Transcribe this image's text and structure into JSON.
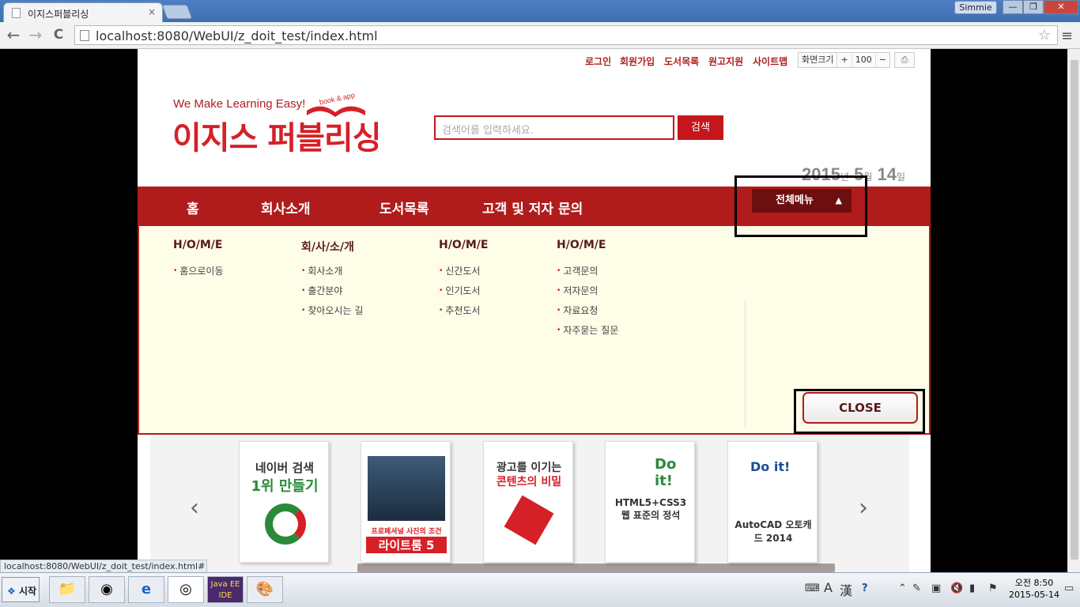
{
  "browser": {
    "tab_title": "이지스퍼블리싱",
    "tab_close": "×",
    "user": "Simmie",
    "win_min": "—",
    "win_restore": "❐",
    "win_close": "✕",
    "back": "←",
    "forward": "→",
    "reload": "C",
    "url": "localhost:8080/WebUI/z_doit_test/index.html",
    "star": "☆",
    "menu": "≡",
    "status_url": "localhost:8080/WebUI/z_doit_test/index.html#"
  },
  "topbar": {
    "links": [
      "로그인",
      "회원가입",
      "도서목록",
      "원고지원",
      "사이트맵"
    ],
    "zoom_label": "화면크기",
    "zoom_plus": "+",
    "zoom_value": "100",
    "zoom_minus": "−",
    "print_icon": "⎙"
  },
  "logo": {
    "tagline": "We Make Learning Easy!",
    "name": "이지스 퍼블리싱",
    "book_app": "book & app"
  },
  "search": {
    "placeholder": "검색어를 입력하세요.",
    "button": "검색"
  },
  "date": {
    "year": "2015",
    "year_unit": "년",
    "month": "5",
    "month_unit": "월",
    "day": "14",
    "day_unit": "일"
  },
  "gnb": {
    "items": [
      "홈",
      "회사소개",
      "도서목록",
      "고객 및 저자 문의"
    ],
    "all_menu": "전체메뉴",
    "all_menu_arrow": "▲"
  },
  "panel": {
    "columns": [
      {
        "head": "H/O/M/E",
        "items": [
          "홈으로이동"
        ]
      },
      {
        "head": "회/사/소/개",
        "items": [
          "회사소개",
          "출간분야",
          "찾아오시는 길"
        ]
      },
      {
        "head": "H/O/M/E",
        "items": [
          "신간도서",
          "인기도서",
          "추천도서"
        ]
      },
      {
        "head": "H/O/M/E",
        "items": [
          "고객문의",
          "저자문의",
          "자료요청",
          "자주묻는 질문"
        ]
      }
    ],
    "close": "CLOSE"
  },
  "carousel": {
    "prev": "‹",
    "next": "›",
    "books": [
      {
        "line1": "네이버 검색",
        "line2": "1위 만들기"
      },
      {
        "line1": "프로페셔널 사진의 조건",
        "line2": "라이트룸 5"
      },
      {
        "line1": "광고를 이기는",
        "line2": "콘텐츠의 비밀"
      },
      {
        "line1": "Do it!",
        "line2": "HTML5+CSS3 웹 표준의 정석"
      },
      {
        "line1": "Do it!",
        "line2": "AutoCAD 오토캐드 2014"
      }
    ]
  },
  "taskbar": {
    "start": "시작",
    "ime_a": "A",
    "ime_han": "漢",
    "clock_line1": "오전 8:50",
    "clock_line2": "2015-05-14"
  },
  "colors": {
    "brand_red": "#c4161c",
    "gnb": "#b01c1c",
    "panel_bg": "#fdfde8"
  }
}
